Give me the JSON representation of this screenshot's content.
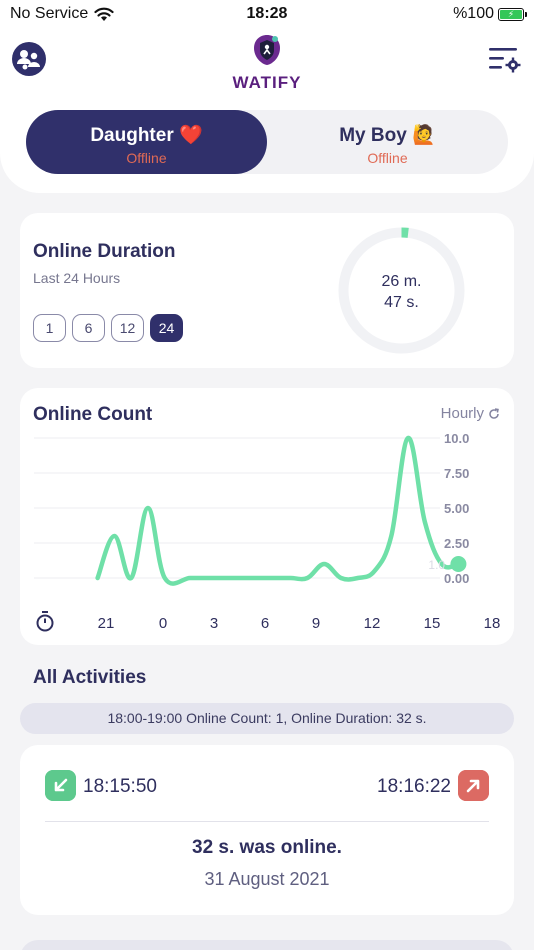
{
  "status_bar": {
    "carrier": "No Service",
    "time": "18:28",
    "battery": "%100"
  },
  "header": {
    "brand": "WATIFY",
    "left_icon": "family-icon",
    "right_icon": "settings-menu-icon"
  },
  "profiles": [
    {
      "name": "Daughter ❤️",
      "status": "Offline",
      "selected": true
    },
    {
      "name": "My Boy 🙋",
      "status": "Offline",
      "selected": false
    }
  ],
  "online_duration": {
    "title": "Online Duration",
    "subtitle": "Last 24 Hours",
    "periods": [
      "1",
      "6",
      "12",
      "24"
    ],
    "selected_period": "24",
    "minutes_label": "26 m.",
    "seconds_label": "47 s.",
    "fraction_of_day": 0.0186
  },
  "online_count": {
    "title": "Online Count",
    "period_label": "Hourly"
  },
  "chart_data": {
    "type": "line",
    "title": "Online Count",
    "x": [
      -5.5,
      -4.5,
      -3.5,
      -2.5,
      -1.5,
      0,
      1,
      2,
      3,
      4,
      5,
      6,
      7,
      8,
      9,
      10,
      11,
      12,
      13,
      14,
      15,
      16
    ],
    "values": [
      0,
      3,
      0,
      5,
      0,
      0,
      0,
      0,
      0,
      0,
      0,
      0,
      0,
      1,
      0,
      0,
      0.5,
      3,
      10,
      4,
      1,
      1
    ],
    "x_tick_labels": [
      "21",
      "0",
      "3",
      "6",
      "9",
      "12",
      "15",
      "18"
    ],
    "y_tick_labels": [
      "10.0",
      "7.50",
      "5.00",
      "2.50",
      "0.00"
    ],
    "ylim": [
      0,
      10
    ],
    "highlight_label": "1.0",
    "line_color": "#6fe0a8",
    "grid": true
  },
  "activities": {
    "title": "All Activities",
    "summary": "18:00-19:00 Online Count: 1, Online Duration: 32 s.",
    "items": [
      {
        "start": "18:15:50",
        "end": "18:16:22",
        "duration_text": "32 s. was online.",
        "date": "31 August 2021"
      }
    ]
  },
  "colors": {
    "primary": "#30306b",
    "offline": "#e06a55",
    "accent_green": "#5dc98d",
    "accent_red": "#dc6a63",
    "brand": "#5a1f7e"
  }
}
